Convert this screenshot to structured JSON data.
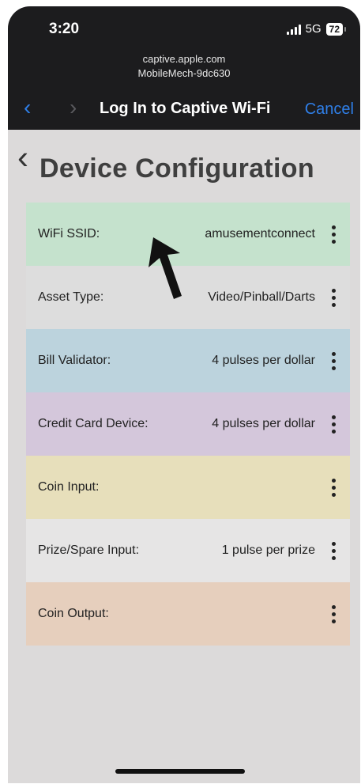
{
  "status_bar": {
    "time": "3:20",
    "network": "5G",
    "battery": "72"
  },
  "browser": {
    "url_line1": "captive.apple.com",
    "url_line2": "MobileMech-9dc630",
    "title": "Log In to Captive Wi-Fi",
    "cancel_label": "Cancel"
  },
  "page": {
    "title": "Device Configuration"
  },
  "rows": [
    {
      "label": "WiFi SSID:",
      "value": "amusementconnect",
      "color": "#c5e2cd"
    },
    {
      "label": "Asset Type:",
      "value": "Video/Pinball/Darts",
      "color": "#dddddd"
    },
    {
      "label": "Bill Validator:",
      "value": "4 pulses per dollar",
      "color": "#bcd3dd"
    },
    {
      "label": "Credit Card Device:",
      "value": "4 pulses per dollar",
      "color": "#d4c7db"
    },
    {
      "label": "Coin Input:",
      "value": "",
      "color": "#e7dfbb"
    },
    {
      "label": "Prize/Spare Input:",
      "value": "1 pulse per prize",
      "color": "#e6e5e5"
    },
    {
      "label": "Coin Output:",
      "value": "",
      "color": "#e6cfbd"
    }
  ],
  "icons": {
    "nav_back": "chevron-left-icon",
    "nav_forward": "chevron-right-icon",
    "page_back": "back-chevron-icon",
    "row_menu": "more-vertical-icon",
    "annotation": "arrow-up-icon"
  }
}
